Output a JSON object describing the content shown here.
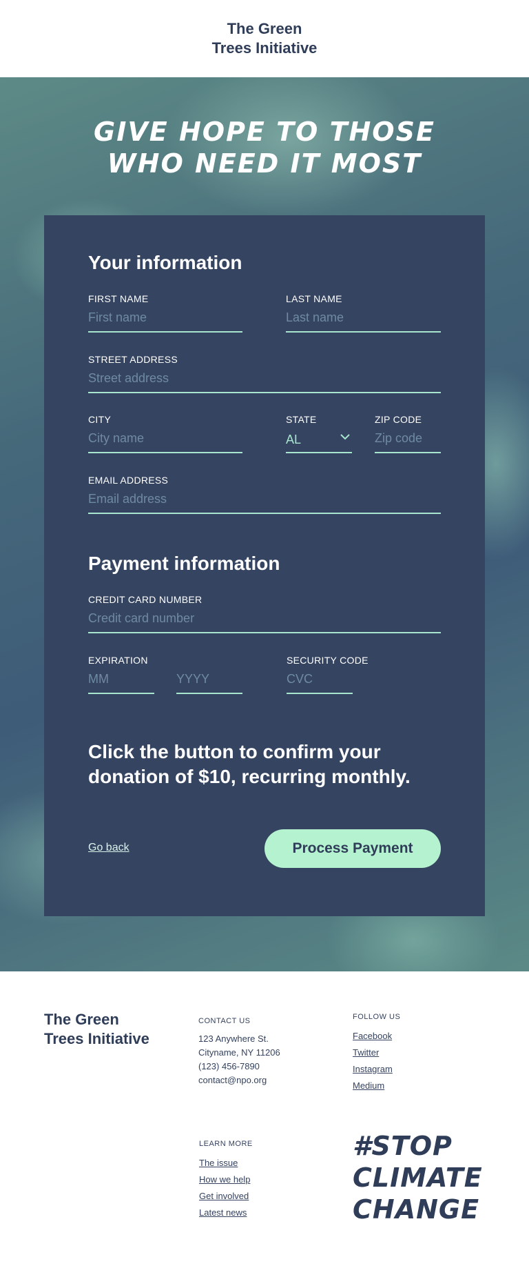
{
  "header": {
    "brand_line1": "The Green",
    "brand_line2": "Trees Initiative"
  },
  "hero": {
    "title_line1": "Give hope to those",
    "title_line2": "who need it most"
  },
  "your_info": {
    "title": "Your information",
    "first_name": {
      "label": "First name",
      "placeholder": "First name"
    },
    "last_name": {
      "label": "Last name",
      "placeholder": "Last name"
    },
    "street": {
      "label": "Street address",
      "placeholder": "Street address"
    },
    "city": {
      "label": "City",
      "placeholder": "City name"
    },
    "state": {
      "label": "State",
      "value": "AL"
    },
    "zip": {
      "label": "Zip code",
      "placeholder": "Zip code"
    },
    "email": {
      "label": "Email address",
      "placeholder": "Email address"
    }
  },
  "payment": {
    "title": "Payment information",
    "card": {
      "label": "Credit card number",
      "placeholder": "Credit card number"
    },
    "expiration": {
      "label": "Expiration",
      "month_placeholder": "MM",
      "year_placeholder": "YYYY"
    },
    "security": {
      "label": "Security code",
      "placeholder": "CVC"
    }
  },
  "confirm_text": "Click the button to confirm your donation of $10, recurring monthly.",
  "actions": {
    "go_back": "Go back",
    "process": "Process Payment"
  },
  "footer": {
    "brand_line1": "The Green",
    "brand_line2": "Trees Initiative",
    "contact": {
      "heading": "Contact us",
      "address1": "123 Anywhere St.",
      "address2": "Cityname, NY 11206",
      "phone": "(123) 456-7890",
      "email": "contact@npo.org"
    },
    "follow": {
      "heading": "Follow us",
      "links": [
        "Facebook",
        "Twitter",
        "Instagram",
        "Medium"
      ]
    },
    "learn": {
      "heading": "Learn more",
      "links": [
        "The issue",
        "How we help",
        "Get involved",
        "Latest news"
      ]
    },
    "hashtag_line1": "#Stop",
    "hashtag_line2": "Climate",
    "hashtag_line3": "Change"
  },
  "colors": {
    "navy": "#354461",
    "mint": "#a8e6cf",
    "button": "#b5f2d0"
  }
}
